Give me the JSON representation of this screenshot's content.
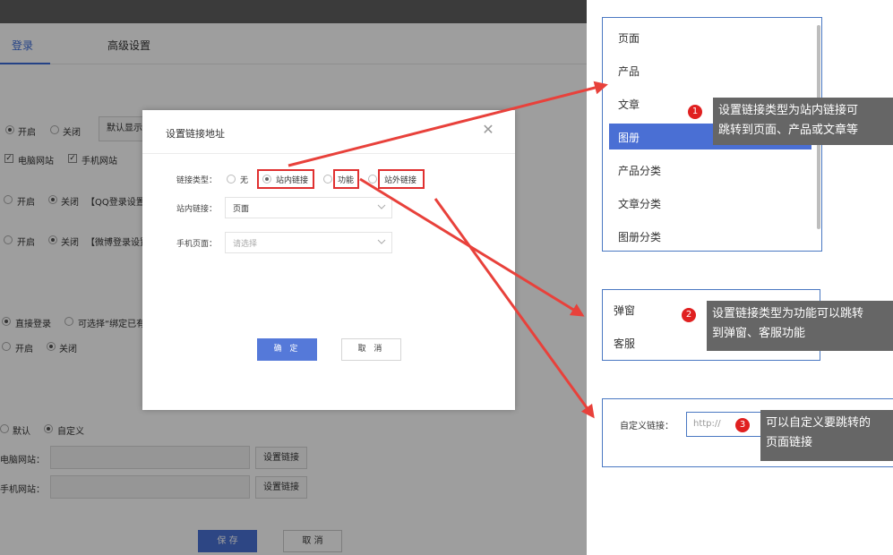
{
  "background": {
    "tabs": [
      "登录",
      "高级设置"
    ],
    "row1": {
      "opt_on": "开启",
      "opt_off": "关闭",
      "button": "默认显示"
    },
    "row2": {
      "pc": "电脑网站",
      "mobile": "手机网站"
    },
    "row3": {
      "opt_on": "开启",
      "opt_off": "关闭",
      "desc": "【QQ登录设置"
    },
    "row4": {
      "opt_on": "开启",
      "opt_off": "关闭",
      "desc": "【微博登录设置"
    },
    "row5": {
      "opt_a": "直接登录",
      "opt_b": "可选择“绑定已有"
    },
    "row6": {
      "opt_on": "开启",
      "opt_off": "关闭"
    },
    "row7": {
      "opt_default": "默认",
      "opt_custom": "自定义"
    },
    "pc_site_label": "电脑网站：",
    "mobile_site_label": "手机网站：",
    "set_link_button": "设置链接",
    "save_button": "保 存",
    "cancel_button": "取 消"
  },
  "dialog": {
    "title": "设置链接地址",
    "link_type_label": "链接类型：",
    "options": [
      "无",
      "站内链接",
      "功能",
      "站外链接"
    ],
    "selected_option": "站内链接",
    "internal_link_label": "站内链接：",
    "internal_link_value": "页面",
    "mobile_page_label": "手机页面：",
    "mobile_page_placeholder": "请选择",
    "ok_button": "确 定",
    "cancel_button": "取 消"
  },
  "panel1": {
    "items": [
      "页面",
      "产品",
      "文章",
      "图册",
      "产品分类",
      "文章分类",
      "图册分类"
    ],
    "highlighted": "图册"
  },
  "panel2": {
    "items": [
      "弹窗",
      "客服"
    ]
  },
  "panel3": {
    "label": "自定义链接：",
    "placeholder": "http://"
  },
  "callouts": [
    {
      "number": "1",
      "text_line1": "设置链接类型为站内链接可",
      "text_line2": "跳转到页面、产品或文章等"
    },
    {
      "number": "2",
      "text_line1": "设置链接类型为功能可以跳转",
      "text_line2": "到弹窗、客服功能"
    },
    {
      "number": "3",
      "text_line1": "可以自定义要跳转的",
      "text_line2": "页面链接"
    }
  ],
  "colors": {
    "accent": "#4a6fd4",
    "annotation_red": "#e03030",
    "callout_bg": "#666666"
  }
}
